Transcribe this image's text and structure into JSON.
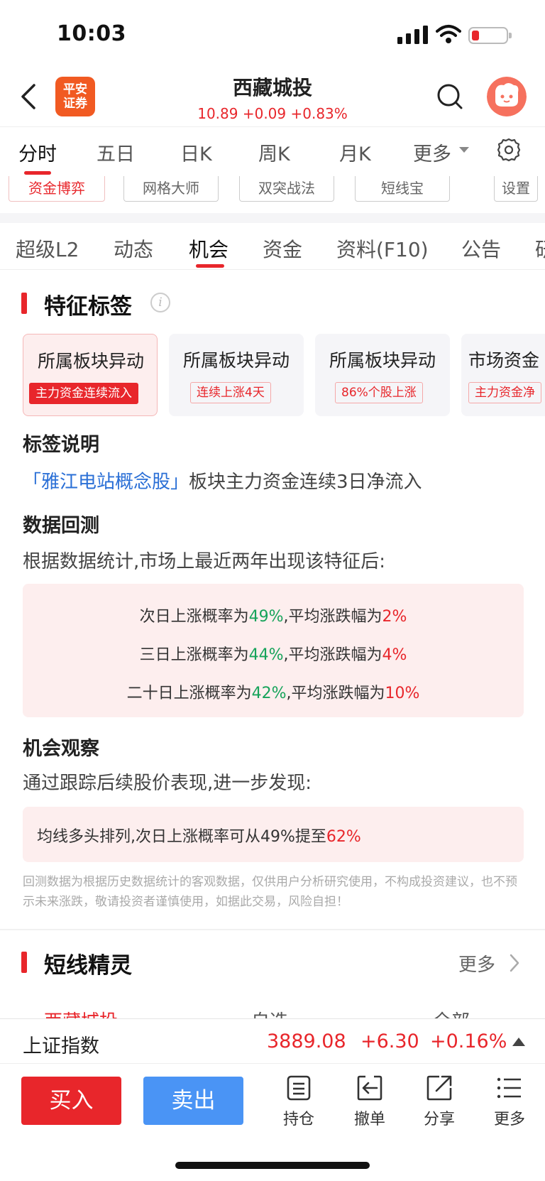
{
  "status": {
    "time": "10:03"
  },
  "header": {
    "logo_line1": "平安",
    "logo_line2": "证券",
    "title": "西藏城投",
    "quote": "10.89 +0.09 +0.83%"
  },
  "chart_tabs": [
    "分时",
    "五日",
    "日K",
    "周K",
    "月K",
    "更多"
  ],
  "tools": [
    "资金博弈",
    "网格大师",
    "双突战法",
    "短线宝",
    "设置"
  ],
  "sub_tabs": [
    "超级L2",
    "动态",
    "机会",
    "资金",
    "资料(F10)",
    "公告",
    "研"
  ],
  "features": {
    "title": "特征标签",
    "info_glyph": "i",
    "cards": [
      {
        "title": "所属板块异动",
        "badge": "主力资金连续流入"
      },
      {
        "title": "所属板块异动",
        "badge": "连续上涨4天"
      },
      {
        "title": "所属板块异动",
        "badge": "86%个股上涨"
      },
      {
        "title": "市场资金",
        "badge": "主力资金净"
      }
    ]
  },
  "desc": {
    "label": "标签说明",
    "link": "「雅江电站概念股」",
    "text": "板块主力资金连续3日净流入"
  },
  "backtest": {
    "label": "数据回测",
    "intro": "根据数据统计,市场上最近两年出现该特征后:",
    "rows": [
      {
        "p1": "次日上涨概率为",
        "v1": "49%",
        "p2": ",平均涨跌幅为",
        "v2": "2%"
      },
      {
        "p1": "三日上涨概率为",
        "v1": "44%",
        "p2": ",平均涨跌幅为",
        "v2": "4%"
      },
      {
        "p1": "二十日上涨概率为",
        "v1": "42%",
        "p2": ",平均涨跌幅为",
        "v2": "10%"
      }
    ]
  },
  "observe": {
    "label": "机会观察",
    "intro": "通过跟踪后续股价表现,进一步发现:",
    "text": "均线多头排列,次日上涨概率可从49%提至",
    "value": "62%"
  },
  "disclaimer": "回测数据为根据历史数据统计的客观数据，仅供用户分析研究使用，不构成投资建议，也不预示未来涨跌，敬请投资者谨慎使用，如据此交易，风险自担！",
  "short_line": {
    "title": "短线精灵",
    "more": "更多",
    "peek": [
      "西藏城投",
      "自选",
      "全部"
    ]
  },
  "index": {
    "name": "上证指数",
    "value": "3889.08",
    "change": "+6.30",
    "pct": "+0.16%"
  },
  "actions": {
    "buy": "买入",
    "sell": "卖出",
    "items": [
      "持仓",
      "撤单",
      "分享",
      "更多"
    ]
  },
  "colors": {
    "up_red": "#e8262b",
    "stat_green": "#16a35a",
    "sell_blue": "#4a94f5"
  }
}
